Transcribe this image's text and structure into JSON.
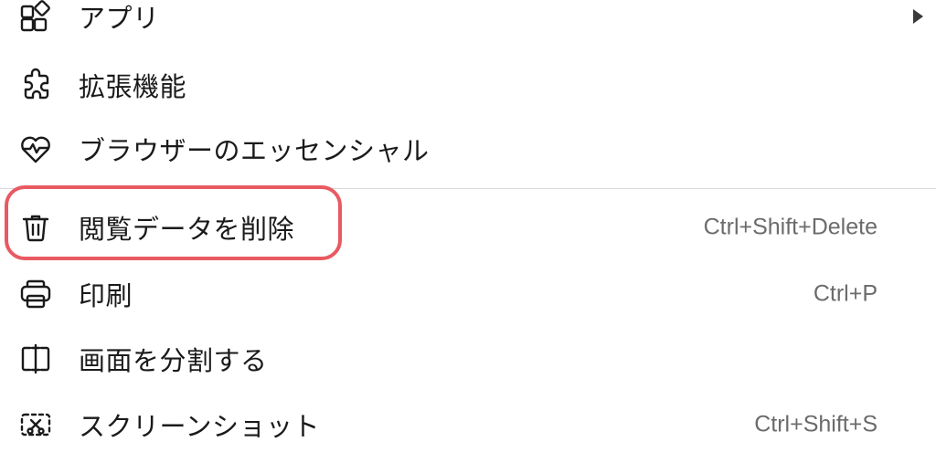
{
  "menu": {
    "items": [
      {
        "id": "apps",
        "label": "アプリ",
        "shortcut": "",
        "icon": "apps-icon",
        "has_submenu": true
      },
      {
        "id": "extensions",
        "label": "拡張機能",
        "shortcut": "",
        "icon": "puzzle-icon",
        "has_submenu": false
      },
      {
        "id": "essentials",
        "label": "ブラウザーのエッセンシャル",
        "shortcut": "",
        "icon": "heart-pulse-icon",
        "has_submenu": false
      },
      {
        "id": "clear-data",
        "label": "閲覧データを削除",
        "shortcut": "Ctrl+Shift+Delete",
        "icon": "trash-icon",
        "has_submenu": false
      },
      {
        "id": "print",
        "label": "印刷",
        "shortcut": "Ctrl+P",
        "icon": "printer-icon",
        "has_submenu": false
      },
      {
        "id": "split-screen",
        "label": "画面を分割する",
        "shortcut": "",
        "icon": "split-screen-icon",
        "has_submenu": false
      },
      {
        "id": "screenshot",
        "label": "スクリーンショット",
        "shortcut": "Ctrl+Shift+S",
        "icon": "screenshot-icon",
        "has_submenu": false
      }
    ]
  },
  "highlight": {
    "target": "clear-data",
    "color": "#e85a62"
  },
  "colors": {
    "text": "#1a1a1a",
    "shortcut": "#6b6b6b",
    "divider": "#d8d8d8"
  }
}
